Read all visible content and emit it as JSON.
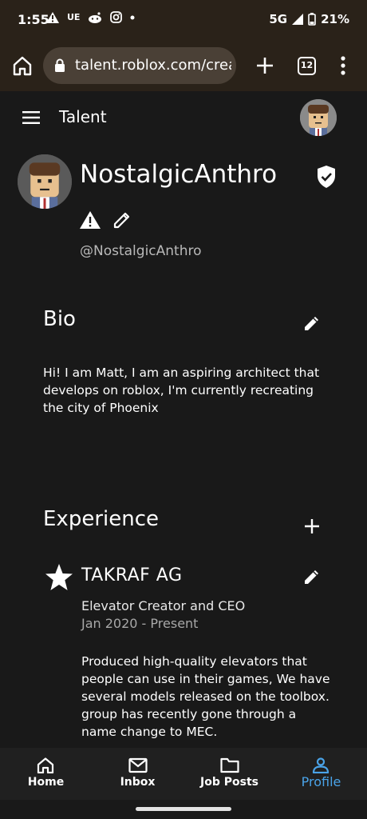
{
  "status_bar": {
    "time": "1:55",
    "notif_text": "UE",
    "network": "5G",
    "battery": "21%"
  },
  "browser": {
    "url": "talent.roblox.com/creators",
    "tab_count": "12"
  },
  "header": {
    "title": "Talent"
  },
  "profile": {
    "display_name": "NostalgicAnthro",
    "handle": "@NostalgicAnthro"
  },
  "bio": {
    "title": "Bio",
    "text": "Hi! I am Matt, I am an aspiring architect that develops on roblox, I'm currently recreating the city of Phoenix"
  },
  "experience": {
    "title": "Experience",
    "items": [
      {
        "company": "TAKRAF AG",
        "role": "Elevator Creator and CEO",
        "dates": "Jan 2020 - Present",
        "description": "Produced high-quality elevators that people can use in their games, We have several models released on the toolbox. group has recently gone through a name change to MEC."
      }
    ]
  },
  "nav": {
    "items": [
      {
        "label": "Home"
      },
      {
        "label": "Inbox"
      },
      {
        "label": "Job Posts"
      },
      {
        "label": "Profile"
      }
    ],
    "active_color": "#4aa3e8"
  }
}
